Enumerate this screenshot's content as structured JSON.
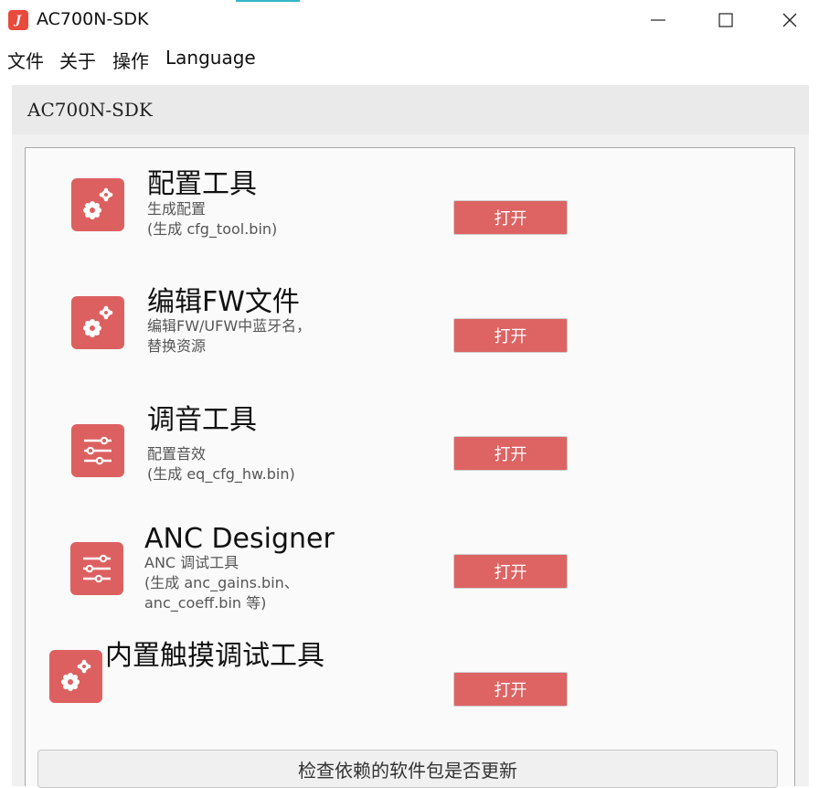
{
  "window": {
    "icon_glyph": "J",
    "title": "AC700N-SDK",
    "controls": [
      "minimize-icon",
      "maximize-icon",
      "close-icon"
    ]
  },
  "menu": [
    "文件",
    "关于",
    "操作",
    "Language"
  ],
  "panel": {
    "title": "AC700N-SDK"
  },
  "tools": [
    {
      "icon": "gears-icon",
      "title": "配置工具",
      "desc": [
        "生成配置",
        "(生成 cfg_tool.bin)"
      ],
      "button": "打开"
    },
    {
      "icon": "gears-icon",
      "title": "编辑FW文件",
      "desc": [
        "编辑FW/UFW中蓝牙名，",
        "替换资源"
      ],
      "button": "打开"
    },
    {
      "icon": "sliders-icon",
      "title": "调音工具",
      "desc": [
        "配置音效",
        "(生成 eq_cfg_hw.bin)"
      ],
      "button": "打开"
    },
    {
      "icon": "sliders-icon",
      "title": "ANC Designer",
      "desc": [
        "ANC 调试工具",
        "(生成 anc_gains.bin、",
        "anc_coeff.bin 等)"
      ],
      "button": "打开"
    },
    {
      "icon": "gears-icon",
      "title": "内置触摸调试工具",
      "desc": [],
      "button": "打开"
    }
  ],
  "footer": {
    "check_button": "检查依赖的软件包是否更新"
  },
  "colors": {
    "accent": "#dd6060",
    "app_icon": "#e84a3c",
    "panel_header": "#eaeaea"
  }
}
